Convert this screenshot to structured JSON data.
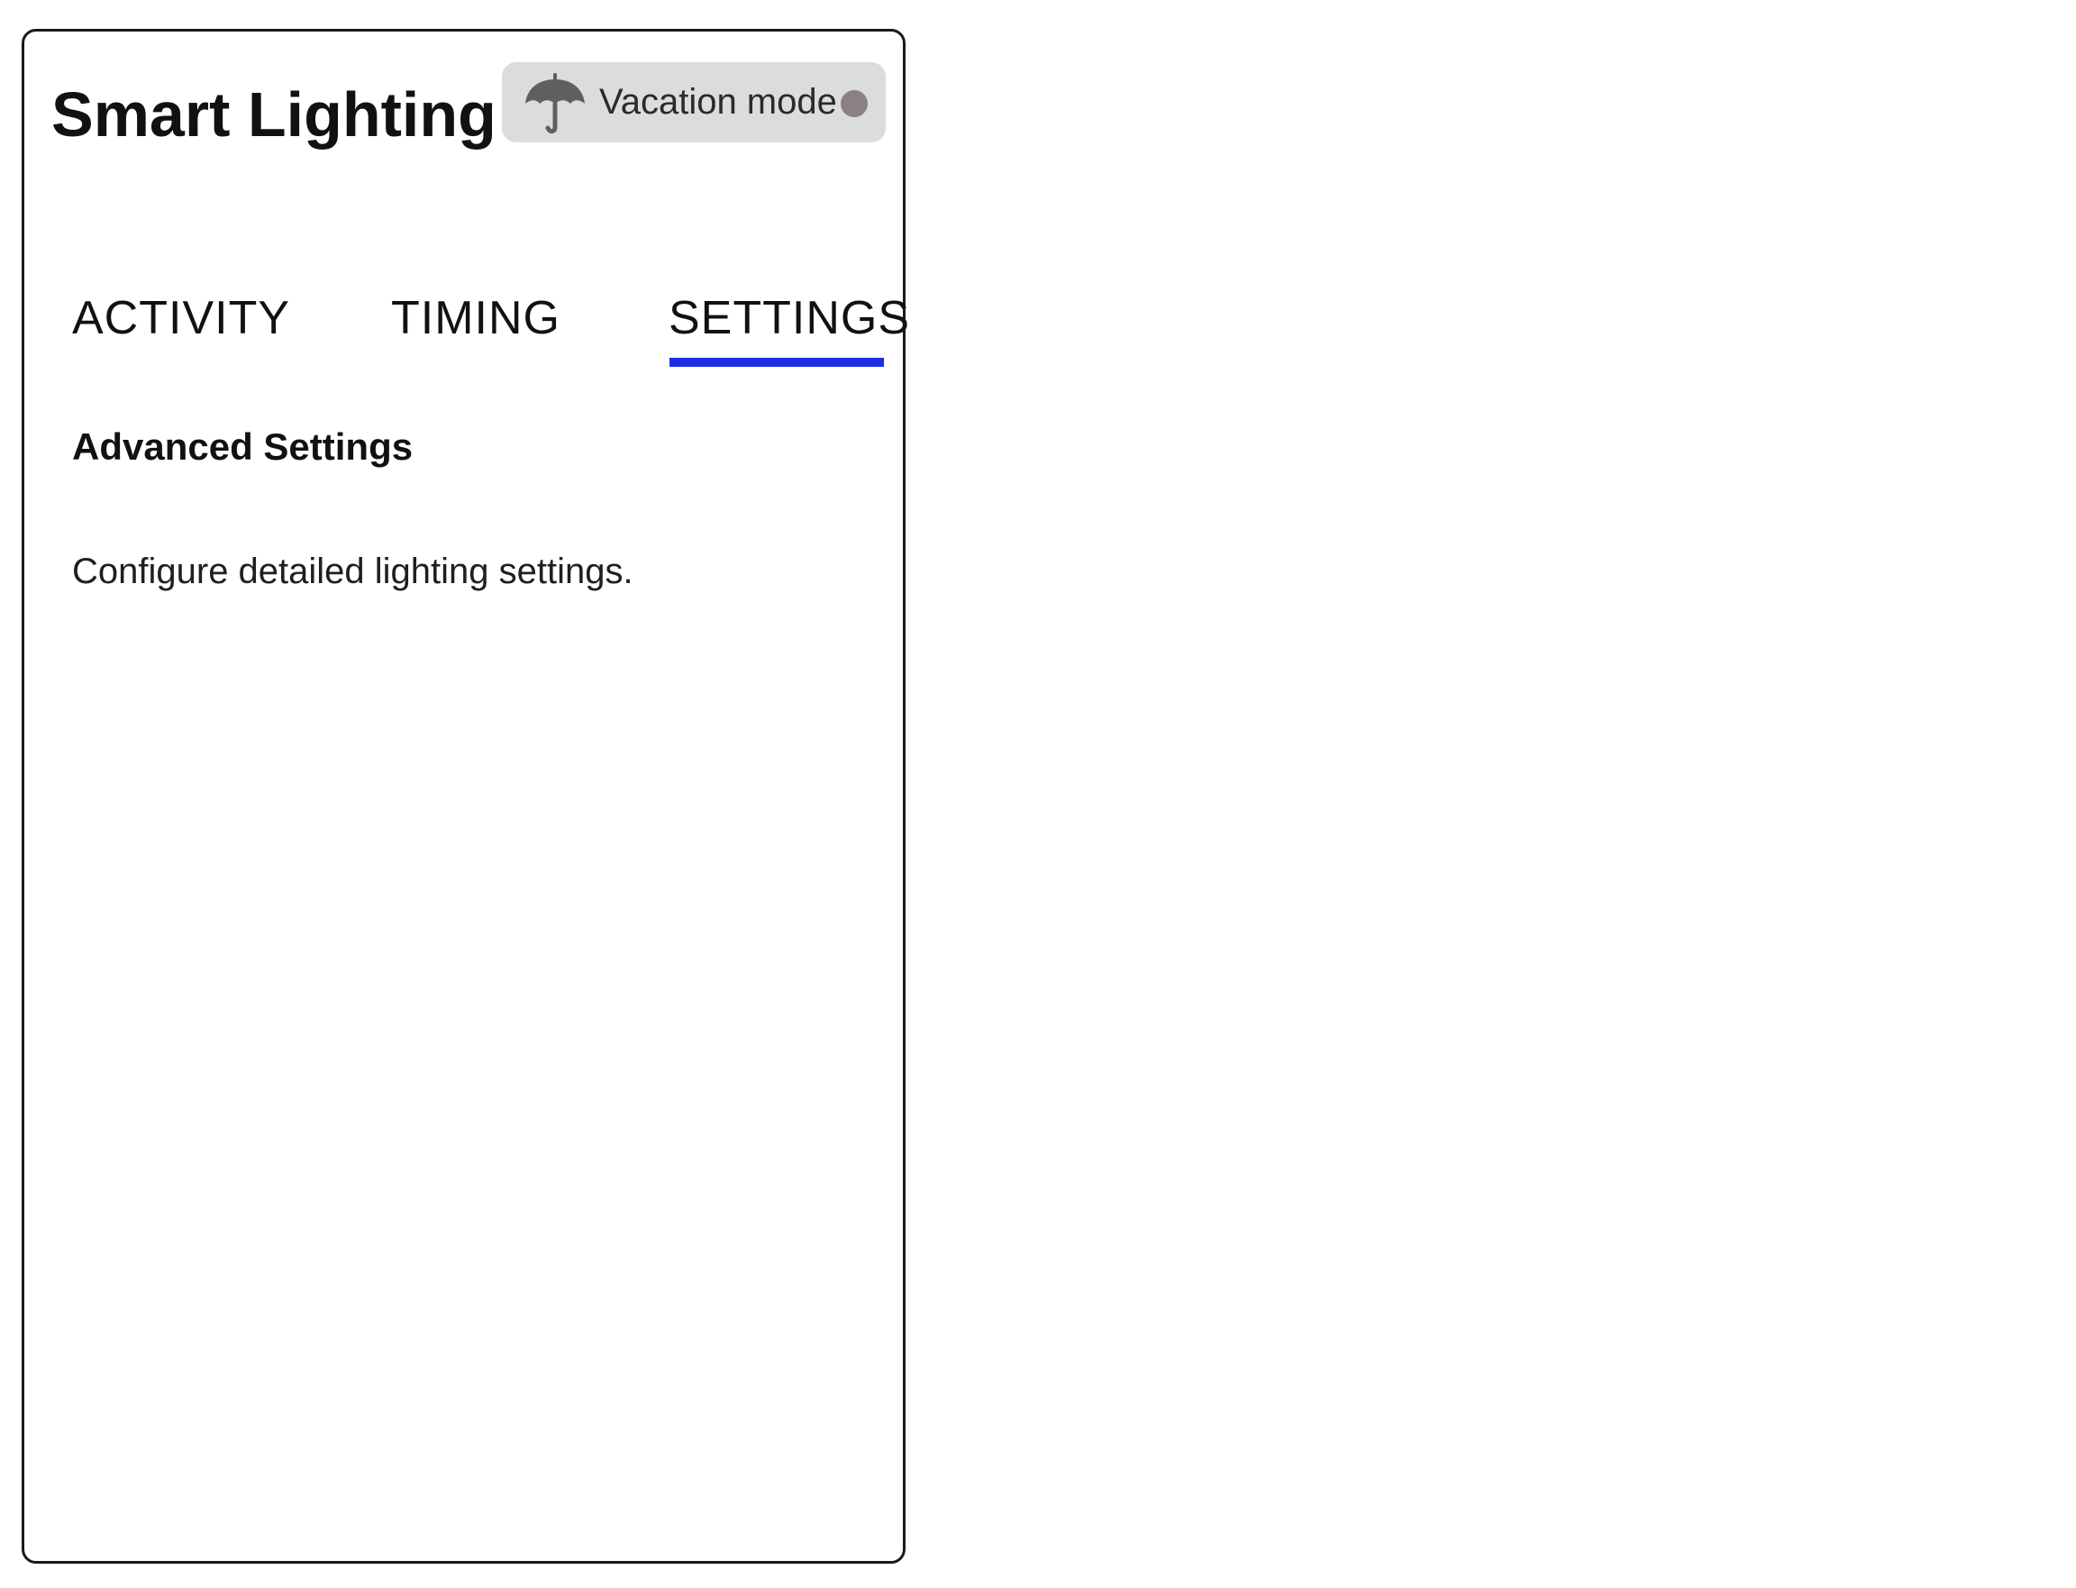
{
  "app": {
    "title": "Smart Lighting"
  },
  "vacation_mode": {
    "label": "Vacation mode",
    "icon": "umbrella-icon",
    "enabled": false,
    "toggle_color": "#8a8282"
  },
  "tabs": [
    {
      "label": "ACTIVITY",
      "active": false
    },
    {
      "label": "TIMING",
      "active": false
    },
    {
      "label": "SETTINGS",
      "active": true
    }
  ],
  "accent_color": "#1c2ee0",
  "settings": {
    "heading": "Advanced Settings",
    "description": "Configure detailed lighting settings."
  }
}
